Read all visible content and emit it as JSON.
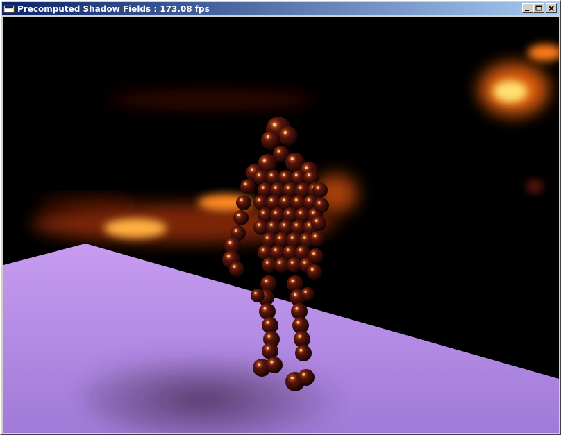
{
  "window": {
    "title": "Precomputed Shadow Fields : 173.08 fps",
    "controls": {
      "minimize": "minimize-icon",
      "maximize": "maximize-icon",
      "close": "close-icon"
    }
  },
  "scene": {
    "background_color": "#000000",
    "floor_color": "#b58ae6",
    "glow_color": "#ffb43c",
    "sphere_color": "#3a0e08"
  }
}
